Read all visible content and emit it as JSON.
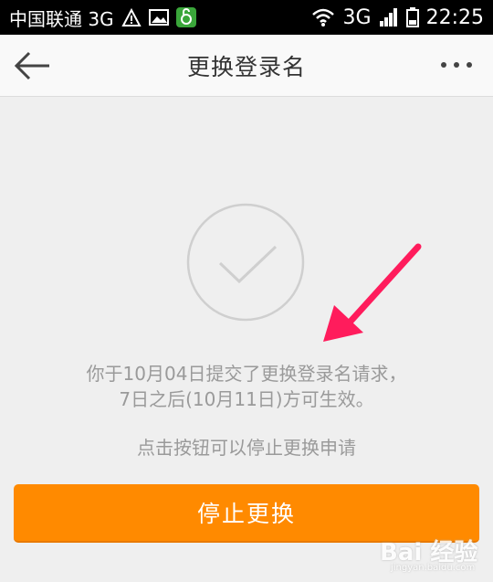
{
  "status_bar": {
    "carrier": "中国联通 3G",
    "network": "3G",
    "time": "22:25"
  },
  "nav": {
    "title": "更换登录名",
    "back_icon": "arrow-left-icon",
    "more_icon": "more-dots-icon"
  },
  "main": {
    "check_icon": "check-circle-icon",
    "message_line1": "你于10月04日提交了更换登录名请求，",
    "message_line2": "7日之后(10月11日)方可生效。",
    "hint": "点击按钮可以停止更换申请",
    "stop_button": "停止更换"
  },
  "watermark": {
    "brand": "Bai 经验",
    "sub": "jingyan.baidu.com"
  },
  "colors": {
    "accent": "#ff8a00",
    "background": "#efefef",
    "annotation_arrow": "#ff1c5c"
  }
}
